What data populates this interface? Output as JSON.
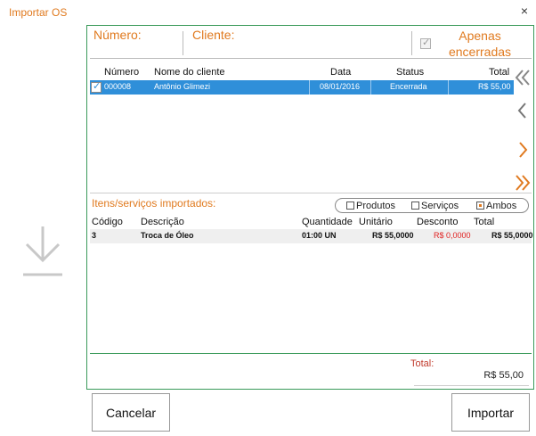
{
  "window": {
    "title": "Importar OS",
    "close_glyph": "×"
  },
  "header": {
    "numero_label": "Número:",
    "cliente_label": "Cliente:",
    "apenas_encerradas_label": "Apenas encerradas",
    "apenas_encerradas_checked": true
  },
  "grid": {
    "columns": [
      "Número",
      "Nome do cliente",
      "Data",
      "Status",
      "Total"
    ],
    "rows": [
      {
        "checked": true,
        "numero": "000008",
        "cliente": "Antônio Glimezi",
        "data": "08/01/2016",
        "status": "Encerrada",
        "total": "R$ 55,00"
      }
    ]
  },
  "nav": {
    "first_icon": "double-chevron-left-icon",
    "prev_icon": "chevron-left-icon",
    "next_icon": "chevron-right-icon",
    "last_icon": "double-chevron-right-icon"
  },
  "items": {
    "title": "Itens/serviços importados:",
    "filter": {
      "produtos": "Produtos",
      "servicos": "Serviços",
      "ambos": "Ambos",
      "selected": "Ambos"
    },
    "columns": [
      "Código",
      "Descrição",
      "Quantidade",
      "Unitário",
      "Desconto",
      "Total"
    ],
    "rows": [
      {
        "codigo": "3",
        "descricao": "Troca de Óleo",
        "quantidade": "01:00 UN",
        "unitario": "R$ 55,0000",
        "desconto": "R$ 0,0000",
        "total": "R$ 55,0000"
      }
    ]
  },
  "totals": {
    "label": "Total:",
    "value": "R$ 55,00"
  },
  "buttons": {
    "cancelar": "Cancelar",
    "importar": "Importar"
  },
  "colors": {
    "accent": "#e07a1f",
    "selection": "#2f8fd9",
    "border_green": "#3a9a5a",
    "discount_red": "#e02020"
  }
}
